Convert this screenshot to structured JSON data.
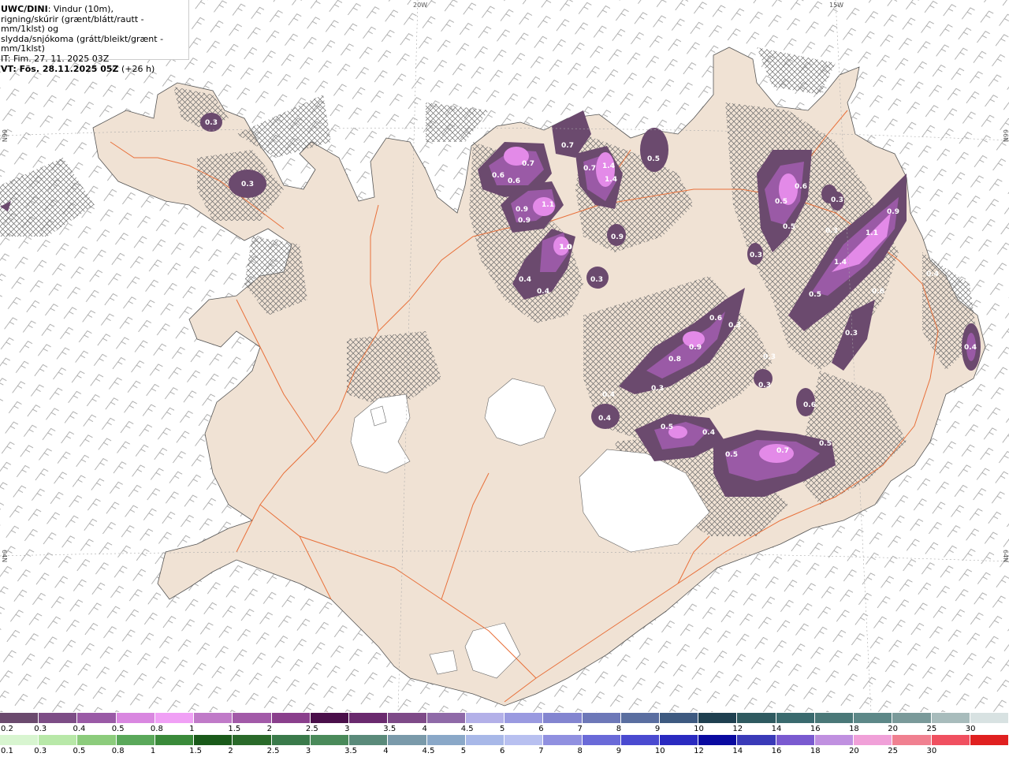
{
  "header": {
    "model": "UWC/DINI",
    "line1_rest": ": Vindur (10m),",
    "line2": "rigning/skúrir (grænt/blátt/rautt - mm/1klst) og",
    "line3": "slydda/snjókoma (grátt/bleikt/grænt - mm/1klst)",
    "issue_time": "IT: Fim. 27. 11. 2025 03Z",
    "valid_time": "VT: Fös. 28.11.2025 05Z",
    "valid_offset": " (+26 h)"
  },
  "graticule_labels": {
    "lon_20w": "20W",
    "lon_15w": "15W",
    "lat_66n_left": "66N",
    "lat_66n_right": "66N",
    "lat_64n_left": "64N",
    "lat_64n_right": "64N"
  },
  "precip_values": [
    "0.3",
    "0.3",
    "0.7",
    "0.7",
    "0.6",
    "0.6",
    "0.9",
    "0.9",
    "1.1",
    "1.0",
    "0.4",
    "0.4",
    "0.7",
    "0.9",
    "1.4",
    "1.4",
    "0.5",
    "0.3",
    "0.3",
    "0.6",
    "0.5",
    "0.5",
    "0.3",
    "1.1",
    "0.9",
    "1.4",
    "0.5",
    "0.6",
    "0.3",
    "0.6",
    "0.3",
    "0.9",
    "0.8",
    "0.3",
    "0.3",
    "0.5",
    "0.5",
    "0.7",
    "0.4",
    "0.4",
    "0.5",
    "0.4",
    "0.4",
    "0.3",
    "0.6",
    "0.3",
    "0.4",
    "1.0"
  ],
  "legend": {
    "snow_colors": [
      "#6b4a6e",
      "#7d4d86",
      "#9a5aa6",
      "#d987e0",
      "#f0a0f5",
      "#c07ac8",
      "#a25aa8",
      "#8a3f8c",
      "#4a0f4a",
      "#6a2a6e",
      "#7e4a88",
      "#8f6aa8",
      "#b3b0e8",
      "#9a9ae0",
      "#8385d0",
      "#6d78b8",
      "#5a6ea0",
      "#3e5a80",
      "#1f4050",
      "#2f5a60",
      "#3a6a6e",
      "#4a7878",
      "#5d8888",
      "#7a9a9a",
      "#a8bcbc",
      "#d8e2e2"
    ],
    "snow_labels": [
      "0.2",
      "0.3",
      "0.4",
      "0.5",
      "0.8",
      "1",
      "1.5",
      "2",
      "2.5",
      "3",
      "3.5",
      "4",
      "4.5",
      "5",
      "6",
      "7",
      "8",
      "9",
      "10",
      "12",
      "14",
      "16",
      "18",
      "20",
      "25",
      "30"
    ],
    "rain_colors": [
      "#d8f5d0",
      "#b8e8a8",
      "#8ccc7c",
      "#5aa85a",
      "#3a8a3a",
      "#1a5a1a",
      "#2a6a2a",
      "#3a7a4a",
      "#4a8a5a",
      "#5a8a7a",
      "#7a9aaa",
      "#8aa8c8",
      "#a8b8e8",
      "#b8c0f0",
      "#9090e0",
      "#6a6ad8",
      "#4a4ad0",
      "#2a2ac0",
      "#0a0aa0",
      "#3a3ab8",
      "#7a5ad0",
      "#c090e0",
      "#f0a0d8",
      "#f08090",
      "#f05060",
      "#e02020"
    ],
    "rain_labels": [
      "0.1",
      "0.3",
      "0.5",
      "0.8",
      "1",
      "1.5",
      "2",
      "2.5",
      "3",
      "3.5",
      "4",
      "4.5",
      "5",
      "6",
      "7",
      "8",
      "9",
      "10",
      "12",
      "14",
      "16",
      "18",
      "20",
      "25",
      "30"
    ]
  },
  "colors": {
    "land": "#f0e2d4",
    "glacier": "#ffffff",
    "roads": "#e8703a",
    "snow_light": "#6b4a6e",
    "snow_mid": "#9a5aa6",
    "snow_high": "#e38ae8",
    "wind_barb": "#909090"
  }
}
